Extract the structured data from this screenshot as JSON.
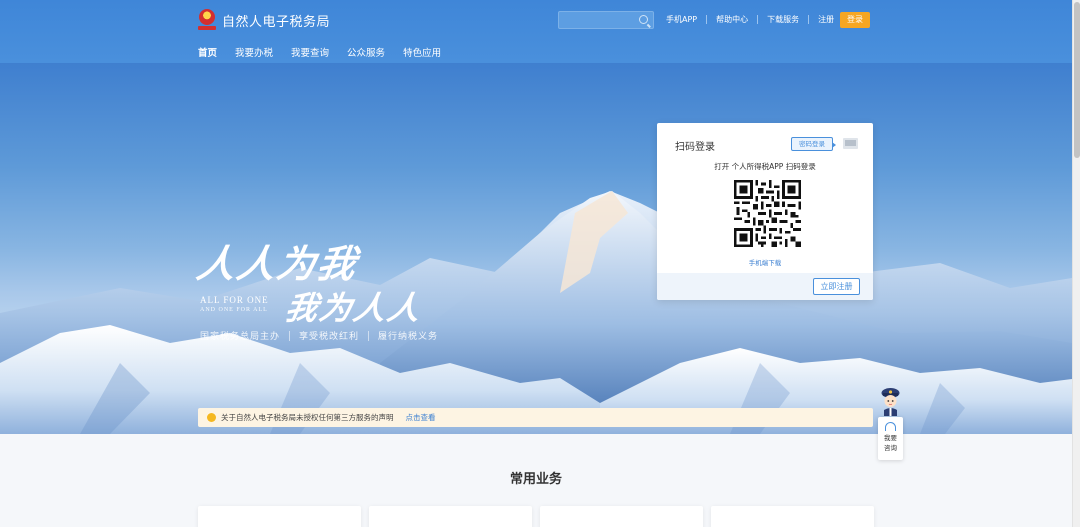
{
  "header": {
    "site_title": "自然人电子税务局",
    "search_placeholder": "",
    "links": [
      "手机APP",
      "帮助中心",
      "下载服务",
      "注册"
    ],
    "login_label": "登录",
    "nav": [
      {
        "label": "首页",
        "active": true
      },
      {
        "label": "我要办税",
        "active": false
      },
      {
        "label": "我要查询",
        "active": false
      },
      {
        "label": "公众服务",
        "active": false
      },
      {
        "label": "特色应用",
        "active": false
      }
    ]
  },
  "hero": {
    "calligraphy_line1": "人人为我",
    "calligraphy_line2": "我为人人",
    "english_line1": "ALL FOR ONE",
    "english_line2": "AND ONE FOR ALL",
    "motto": [
      "国家税务总局主办",
      "享受税改红利",
      "履行纳税义务"
    ]
  },
  "login_card": {
    "title": "扫码登录",
    "password_login_tag": "密码登录",
    "scan_hint": "打开 个人所得税APP 扫码登录",
    "download_link": "手机端下载",
    "register_button": "立即注册"
  },
  "notice": {
    "text": "关于自然人电子税务局未授权任何第三方服务的声明",
    "link": "点击查看"
  },
  "assistant": {
    "line1": "我要",
    "line2": "咨询"
  },
  "section": {
    "title": "常用业务"
  },
  "colors": {
    "header_blue": "#4a90dc",
    "login_orange": "#f5a623",
    "notice_bg": "#fdf4e3",
    "link_blue": "#3b7fd1"
  },
  "icons": [
    "national-emblem-icon",
    "search-icon",
    "pc-switch-icon",
    "qr-code-icon",
    "notice-icon",
    "headset-icon",
    "tax-officer-avatar-icon"
  ]
}
